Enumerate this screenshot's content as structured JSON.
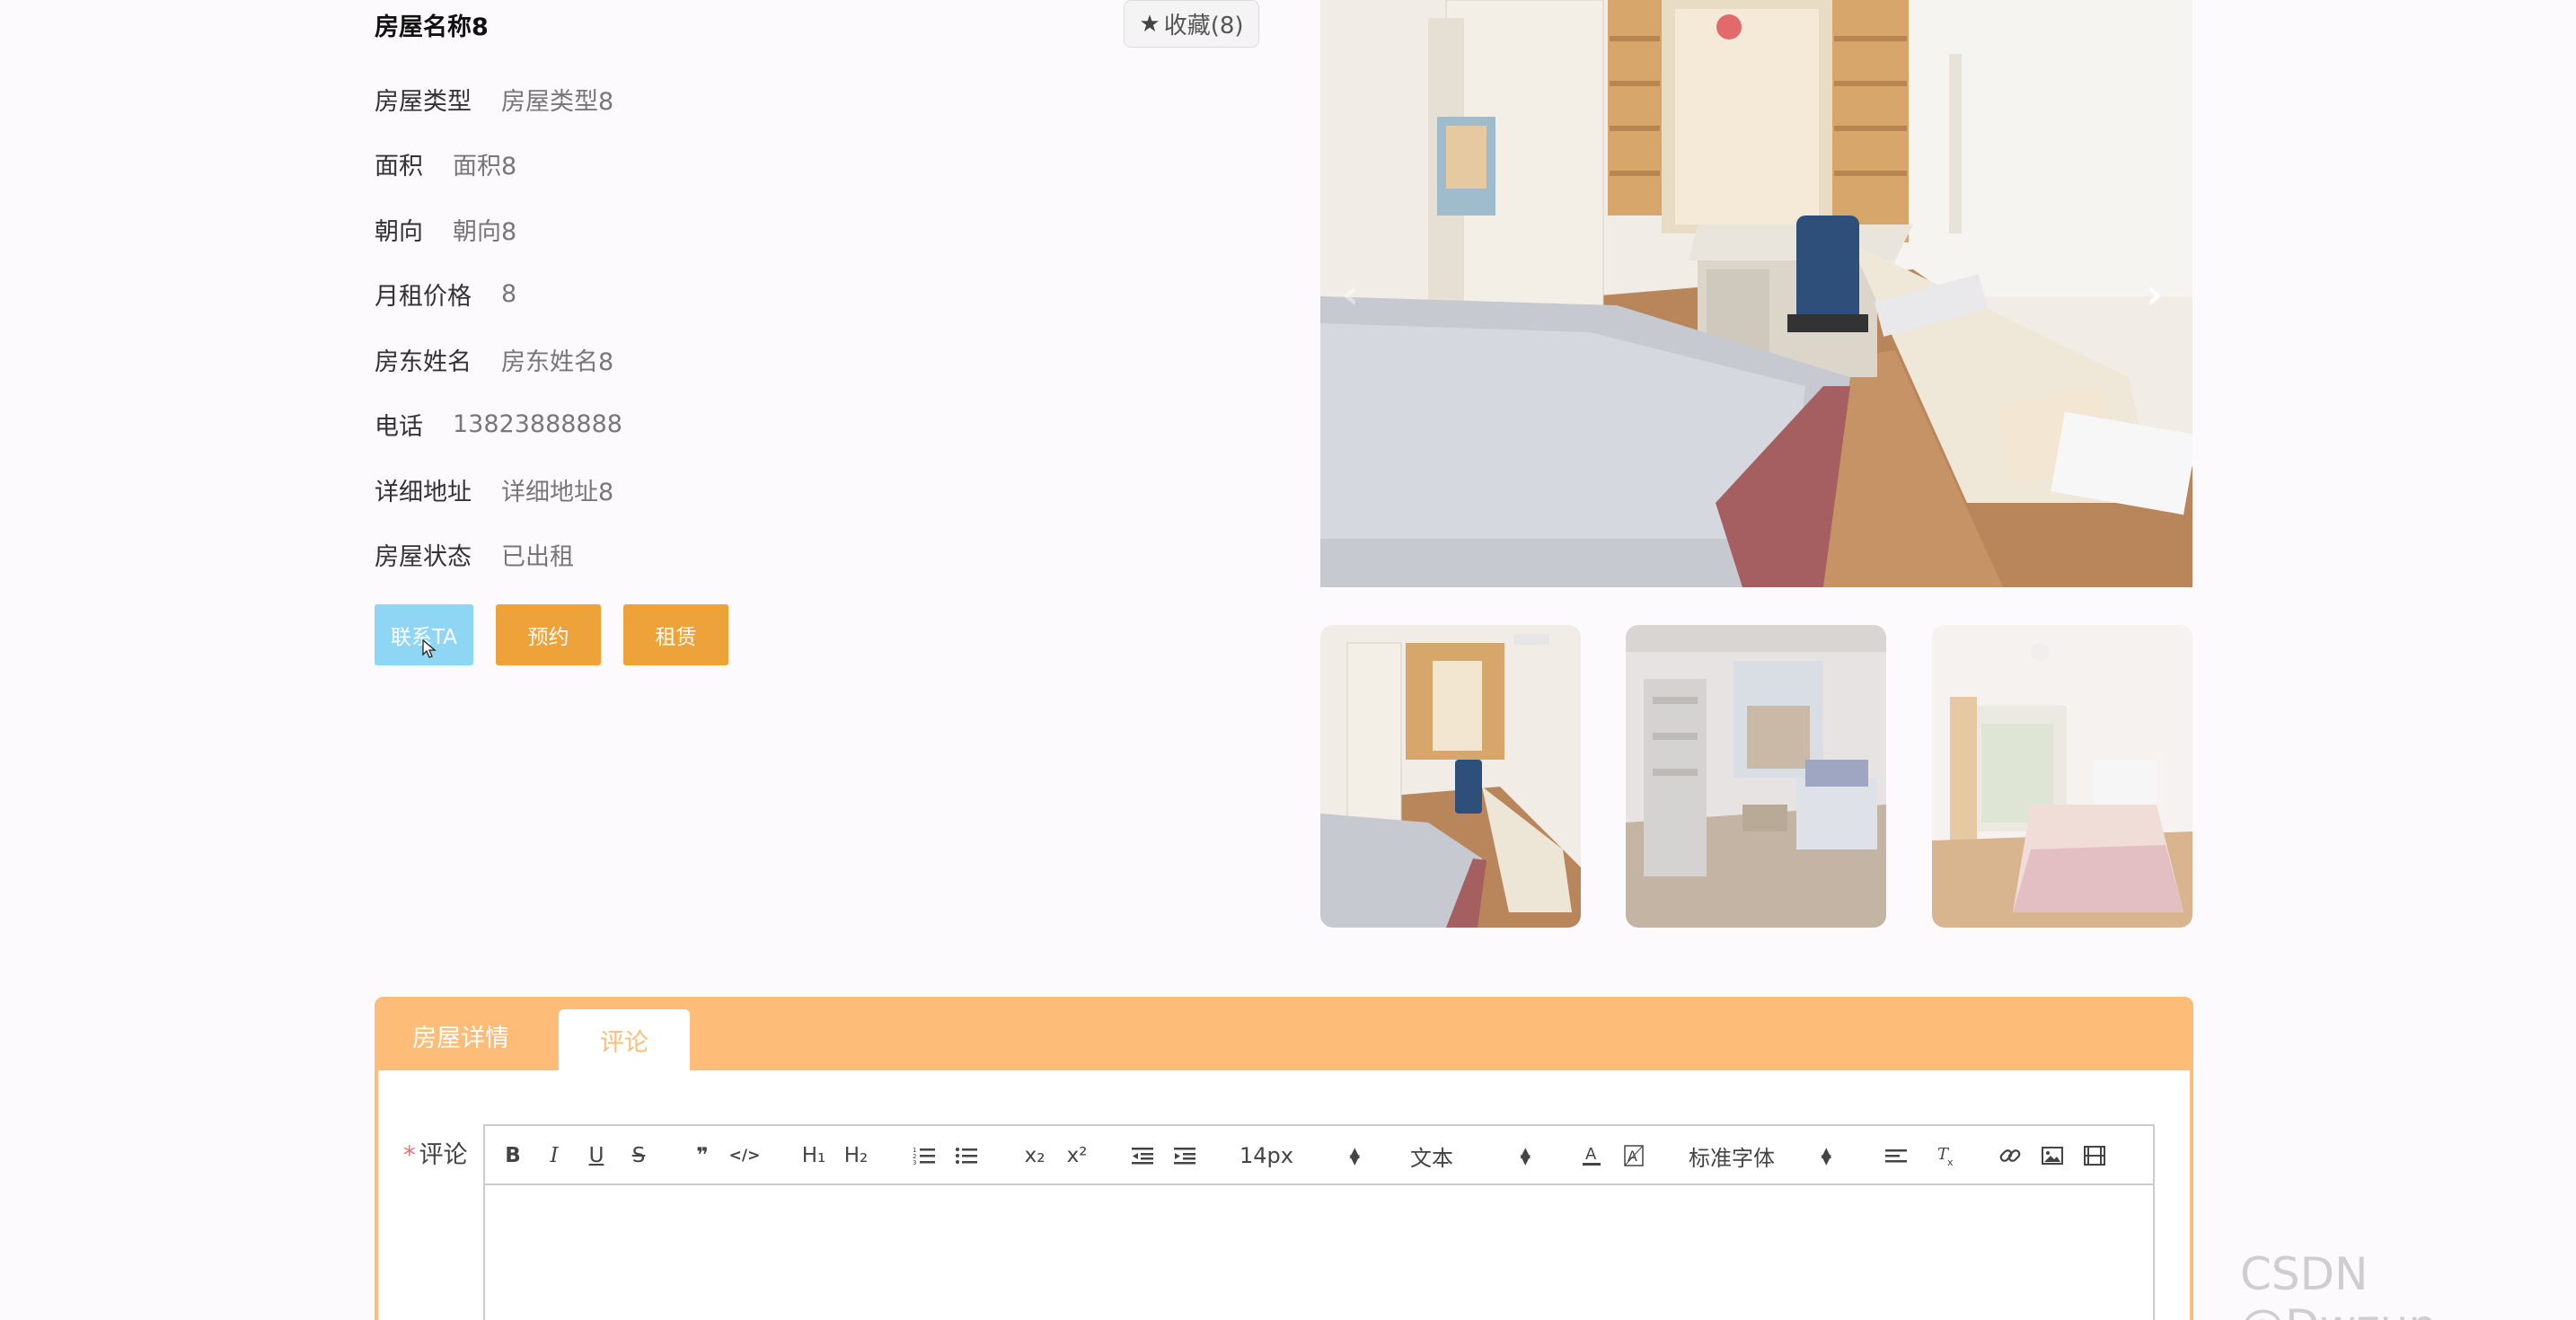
{
  "house": {
    "name": "房屋名称8",
    "favorite_label": "收藏(8)",
    "fields": [
      {
        "label": "房屋类型",
        "value": "房屋类型8"
      },
      {
        "label": "面积",
        "value": "面积8"
      },
      {
        "label": "朝向",
        "value": "朝向8"
      },
      {
        "label": "月租价格",
        "value": "8"
      },
      {
        "label": "房东姓名",
        "value": "房东姓名8"
      },
      {
        "label": "电话",
        "value": "13823888888"
      },
      {
        "label": "详细地址",
        "value": "详细地址8"
      },
      {
        "label": "房屋状态",
        "value": "已出租"
      }
    ]
  },
  "actions": {
    "contact": "联系TA",
    "book": "预约",
    "rent": "租赁"
  },
  "gallery": {
    "prev_arrow": "‹",
    "next_arrow": "›",
    "images": [
      "bedroom-study",
      "loft-living-room",
      "bright-bedroom"
    ]
  },
  "tabs": {
    "detail": "房屋详情",
    "comment": "评论"
  },
  "form": {
    "required_mark": "*",
    "comment_label": "评论"
  },
  "editor": {
    "font_size": "14px",
    "heading": "文本",
    "font_family": "标准字体",
    "buttons": {
      "bold": "B",
      "italic": "I",
      "underline": "U",
      "strike": "S",
      "quote": "❞",
      "code": "</>",
      "h1": "H₁",
      "h2": "H₂",
      "subscript": "x₂",
      "superscript": "x²"
    }
  },
  "watermark": "CSDN @Dwzun",
  "colors": {
    "accent": "#fdbd78",
    "button_orange": "#eda23a",
    "button_blue": "#8ed6f3",
    "required": "#f56c6c"
  }
}
